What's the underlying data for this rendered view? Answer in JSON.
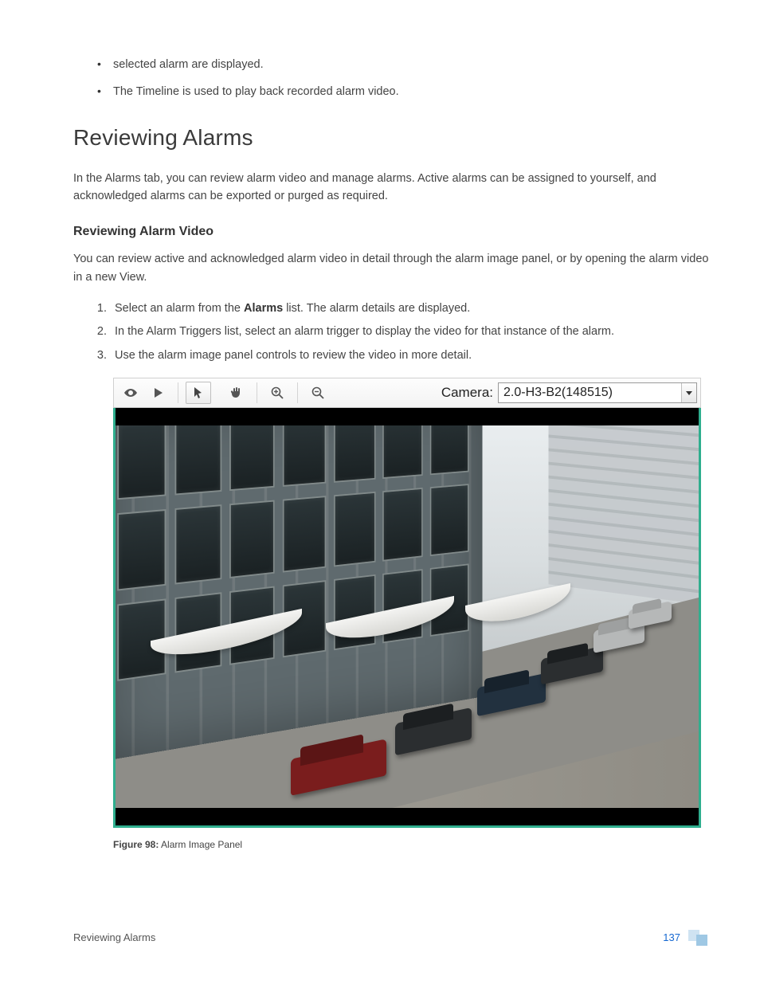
{
  "fragment": {
    "prev_text_tail": "selected alarm are displayed.",
    "bullet2": "The Timeline is used to play back recorded alarm video."
  },
  "section": {
    "title": "Reviewing Alarms",
    "intro": "In the Alarms tab, you can review alarm video and manage alarms. Active alarms can be assigned to yourself, and acknowledged alarms can be exported or purged as required."
  },
  "subsection": {
    "title": "Reviewing Alarm Video",
    "intro": "You can review active and acknowledged alarm video in detail through the alarm image panel, or by opening the alarm video in a new View.",
    "steps": {
      "s1_pre": "Select an alarm from the ",
      "s1_bold": "Alarms",
      "s1_post": " list. The alarm details are displayed.",
      "s2": "In the Alarm Triggers list, select an alarm trigger to display the video for that instance of the alarm.",
      "s3": "Use the alarm image panel controls to review the video in more detail."
    }
  },
  "image_panel": {
    "camera_label": "Camera:",
    "camera_value": "2.0-H3-B2(148515)",
    "icons": {
      "eye": "eye-icon",
      "play": "play-icon",
      "pointer": "pointer-icon",
      "hand": "hand-icon",
      "zoom_in": "zoom-in-icon",
      "zoom_out": "zoom-out-icon"
    }
  },
  "figure": {
    "label": "Figure 98:",
    "caption": "Alarm Image Panel"
  },
  "footer": {
    "title": "Reviewing Alarms",
    "page": "137"
  }
}
